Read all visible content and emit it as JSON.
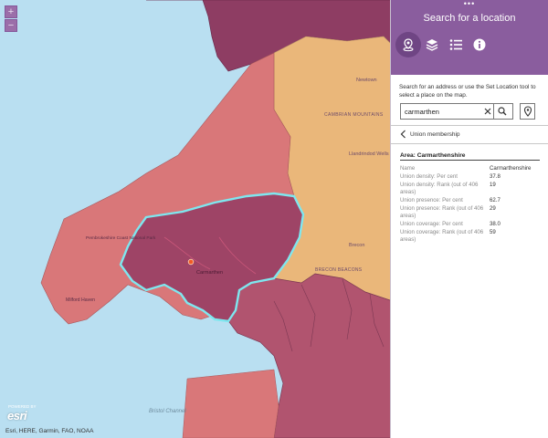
{
  "map": {
    "zoom_in": "+",
    "zoom_out": "−",
    "labels": {
      "cambrian": "CAMBRIAN MOUNTAINS",
      "newtown": "Newtown",
      "llandrindod": "Llandrindod Wells",
      "brecon": "Brecon",
      "brecon_beacons": "BRECON BEACONS",
      "pembrokeshire": "Pembrokeshire Coast National Park",
      "carmarthen": "Carmarthen",
      "milford": "Milford Haven",
      "bristol_channel": "Bristol Channel"
    },
    "attribution": "Esri, HERE, Garmin, FAO, NOAA",
    "esri_powered": "POWERED BY",
    "esri_logo": "esri",
    "colors": {
      "sea": "#b9dff1",
      "darkest": "#8e3d63",
      "mid": "#b1546f",
      "light": "#d97779",
      "orange": "#eab77a",
      "highlight": "#7ee7ef"
    }
  },
  "panel": {
    "drag_handle": "•••",
    "title": "Search for a location",
    "tabs": [
      {
        "icon": "location-search-icon",
        "active": true
      },
      {
        "icon": "layers-icon",
        "active": false
      },
      {
        "icon": "legend-list-icon",
        "active": false
      },
      {
        "icon": "info-icon",
        "active": false
      }
    ],
    "instructions": "Search for an address or use the Set Location tool to select a place on the map.",
    "search": {
      "value": "carmarthen",
      "placeholder": ""
    },
    "back_label": "Union membership",
    "area_title": "Area: Carmarthenshire",
    "attributes": [
      {
        "key": "Name",
        "value": "Carmarthenshire"
      },
      {
        "key": "Union density: Per cent",
        "value": "37.8"
      },
      {
        "key": "Union density: Rank (out of 406 areas)",
        "value": "19"
      },
      {
        "key": "Union presence: Per cent",
        "value": "62.7"
      },
      {
        "key": "Union presence: Rank (out of 406 areas)",
        "value": "29"
      },
      {
        "key": "Union coverage: Per cent",
        "value": "38.0"
      },
      {
        "key": "Union coverage: Rank (out of 406 areas)",
        "value": "59"
      }
    ]
  }
}
